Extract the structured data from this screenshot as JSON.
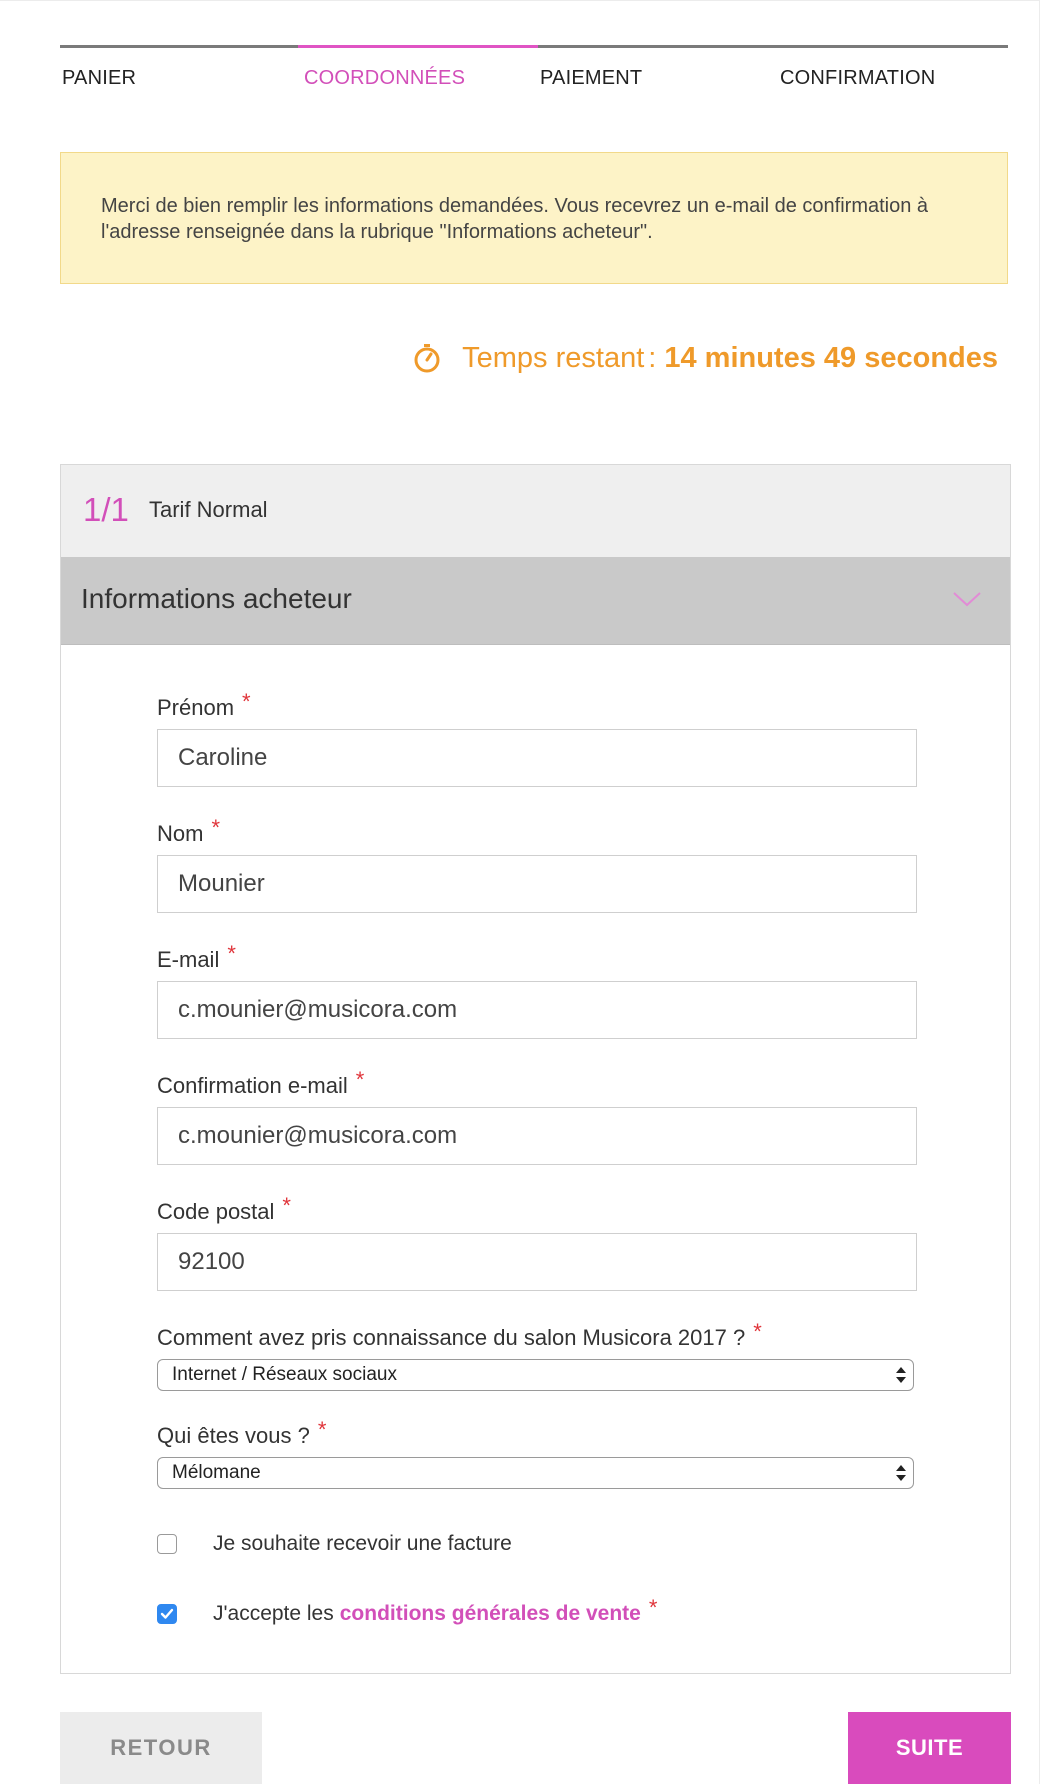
{
  "steps": [
    {
      "label": "PANIER"
    },
    {
      "label": "COORDONNÉES"
    },
    {
      "label": "PAIEMENT"
    },
    {
      "label": "CONFIRMATION"
    }
  ],
  "active_step": "COORDONNÉES",
  "notice": {
    "text": "Merci de bien remplir les informations demandées. Vous recevrez un e-mail de confirmation à l'adresse renseignée dans la rubrique \"Informations acheteur\"."
  },
  "timer": {
    "icon": "stopwatch-icon",
    "prefix": "Temps restant",
    "separator": ":",
    "value": "14 minutes 49 secondes"
  },
  "ticket": {
    "counter": "1/1",
    "tarif": "Tarif Normal"
  },
  "buyer": {
    "section_title": "Informations acheteur",
    "required_mark": "*",
    "fields": {
      "first_name": {
        "label": "Prénom",
        "value": "Caroline"
      },
      "last_name": {
        "label": "Nom",
        "value": "Mounier"
      },
      "email": {
        "label": "E-mail",
        "value": "c.mounier@musicora.com"
      },
      "email_confirm": {
        "label": "Confirmation e-mail",
        "value": "c.mounier@musicora.com"
      },
      "postal_code": {
        "label": "Code postal",
        "value": "92100"
      }
    },
    "source_select": {
      "label": "Comment avez pris connaissance du salon Musicora 2017 ?",
      "value": "Internet / Réseaux sociaux"
    },
    "profile_select": {
      "label": "Qui êtes vous ?",
      "value": "Mélomane"
    },
    "invoice_checkbox": {
      "label": "Je souhaite recevoir une facture",
      "checked": false
    },
    "terms_checkbox": {
      "label_prefix": "J'accepte les",
      "link": "conditions générales de vente",
      "checked": true
    }
  },
  "buttons": {
    "back": "RETOUR",
    "next": "SUITE"
  },
  "colors": {
    "accent": "#d94bbd",
    "timer": "#ef9a2a",
    "notice_bg": "#fdf3c7",
    "required": "#e0353b",
    "checkbox": "#2f88f0"
  }
}
